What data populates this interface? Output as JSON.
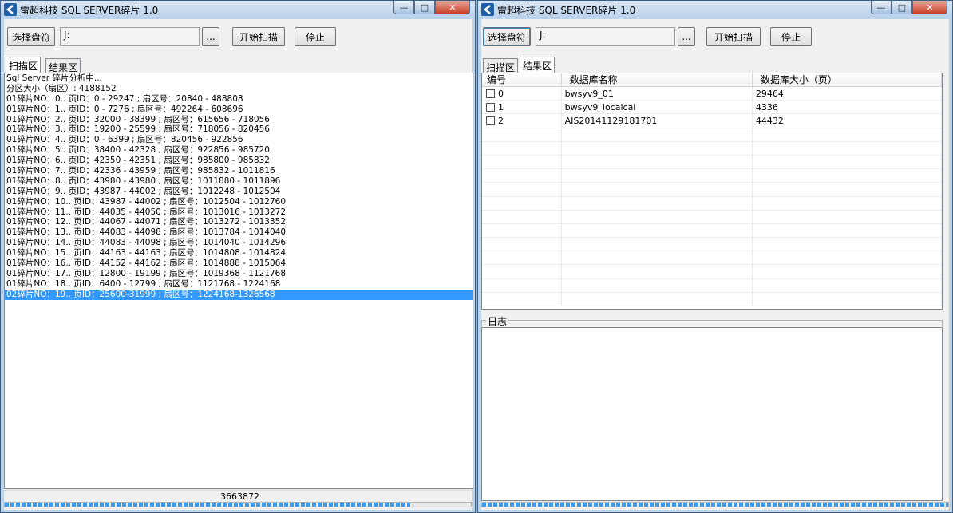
{
  "left_window": {
    "title": "雷超科技 SQL SERVER碎片 1.0",
    "toolbar": {
      "select_drive_label": "选择盘符",
      "path_value": "J:",
      "browse_label": "...",
      "start_scan_label": "开始扫描",
      "stop_label": "停止"
    },
    "tabs": [
      {
        "label": "扫描区",
        "active": true
      },
      {
        "label": "结果区",
        "active": false
      }
    ],
    "log_lines": [
      "Sql Server 碎片分析中...",
      "分区大小（扇区）: 4188152",
      "01碎片NO：0.. 页ID：0 - 29247 ; 扇区号：20840 - 488808",
      "01碎片NO：1.. 页ID：0 - 7276 ; 扇区号：492264 - 608696",
      "01碎片NO：2.. 页ID：32000 - 38399 ; 扇区号：615656 - 718056",
      "01碎片NO：3.. 页ID：19200 - 25599 ; 扇区号：718056 - 820456",
      "01碎片NO：4.. 页ID：0 - 6399 ; 扇区号：820456 - 922856",
      "01碎片NO：5.. 页ID：38400 - 42328 ; 扇区号：922856 - 985720",
      "01碎片NO：6.. 页ID：42350 - 42351 ; 扇区号：985800 - 985832",
      "01碎片NO：7.. 页ID：42336 - 43959 ; 扇区号：985832 - 1011816",
      "01碎片NO：8.. 页ID：43980 - 43980 ; 扇区号：1011880 - 1011896",
      "01碎片NO：9.. 页ID：43987 - 44002 ; 扇区号：1012248 - 1012504",
      "01碎片NO：10.. 页ID：43987 - 44002 ; 扇区号：1012504 - 1012760",
      "01碎片NO：11.. 页ID：44035 - 44050 ; 扇区号：1013016 - 1013272",
      "01碎片NO：12.. 页ID：44067 - 44071 ; 扇区号：1013272 - 1013352",
      "01碎片NO：13.. 页ID：44083 - 44098 ; 扇区号：1013784 - 1014040",
      "01碎片NO：14.. 页ID：44083 - 44098 ; 扇区号：1014040 - 1014296",
      "01碎片NO：15.. 页ID：44163 - 44163 ; 扇区号：1014808 - 1014824",
      "01碎片NO：16.. 页ID：44152 - 44162 ; 扇区号：1014888 - 1015064",
      "01碎片NO：17.. 页ID：12800 - 19199 ; 扇区号：1019368 - 1121768",
      "01碎片NO：18.. 页ID：6400 - 12799 ; 扇区号：1121768 - 1224168",
      "02碎片NO：19.. 页ID：25600-31999 ; 扇区号：1224168-1326568"
    ],
    "selected_line_index": 21,
    "status_value": "3663872",
    "progress_fraction": 0.87
  },
  "right_window": {
    "title": "雷超科技 SQL SERVER碎片 1.0",
    "toolbar": {
      "select_drive_label": "选择盘符",
      "path_value": "J:",
      "browse_label": "...",
      "start_scan_label": "开始扫描",
      "stop_label": "停止"
    },
    "tabs": [
      {
        "label": "扫描区",
        "active": false
      },
      {
        "label": "结果区",
        "active": true
      }
    ],
    "list_columns": [
      "编号",
      "数据库名称",
      "数据库大小（页）"
    ],
    "list_rows": [
      {
        "id": "0",
        "name": "bwsyv9_01",
        "size": "29464",
        "checked": false
      },
      {
        "id": "1",
        "name": "bwsyv9_localcal",
        "size": "4336",
        "checked": false
      },
      {
        "id": "2",
        "name": "AIS20141129181701",
        "size": "44432",
        "checked": false
      }
    ],
    "log_group_label": "日志",
    "progress_fraction": 1.0
  }
}
